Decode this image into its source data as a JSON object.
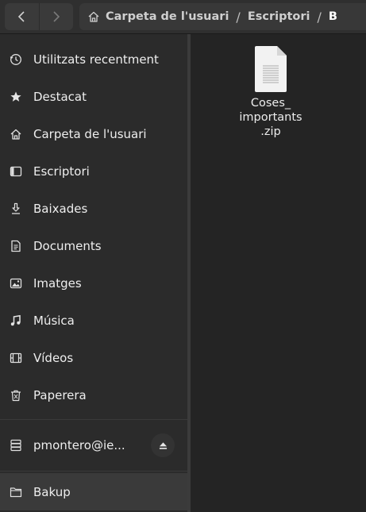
{
  "header": {
    "path": {
      "home": "Carpeta de l'usuari",
      "crumbs": [
        "Escriptori",
        "B"
      ],
      "separator": "/"
    }
  },
  "sidebar": {
    "items": [
      {
        "label": "Utilitzats recentment",
        "icon": "clock-icon"
      },
      {
        "label": "Destacat",
        "icon": "star-icon"
      },
      {
        "label": "Carpeta de l'usuari",
        "icon": "home-icon"
      },
      {
        "label": "Escriptori",
        "icon": "desktop-icon"
      },
      {
        "label": "Baixades",
        "icon": "download-icon"
      },
      {
        "label": "Documents",
        "icon": "document-icon"
      },
      {
        "label": "Imatges",
        "icon": "image-icon"
      },
      {
        "label": "Música",
        "icon": "music-icon"
      },
      {
        "label": "Vídeos",
        "icon": "video-icon"
      },
      {
        "label": "Paperera",
        "icon": "trash-icon"
      }
    ],
    "drive": {
      "label": "pmontero@ie...",
      "icon": "drive-icon",
      "eject_icon": "eject-icon"
    },
    "bookmark": {
      "label": "Bakup",
      "icon": "folder-icon",
      "selected": true
    }
  },
  "content": {
    "files": [
      {
        "name_lines": [
          "Coses_",
          "importants",
          ".zip"
        ],
        "icon": "archive-file-icon"
      }
    ]
  },
  "colors": {
    "background": "#242424",
    "sidebar": "#2b2b2b",
    "selected": "#3a3a3a",
    "text": "#eeeeee"
  }
}
